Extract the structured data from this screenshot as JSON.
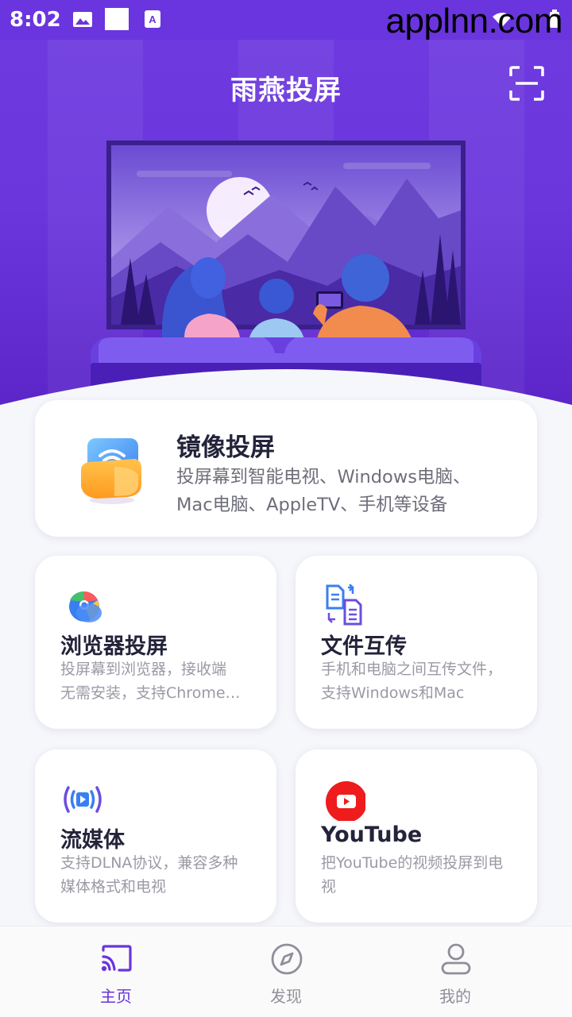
{
  "status_bar": {
    "time": "8:02",
    "icons": [
      "image-icon",
      "square-icon",
      "font-icon",
      "wifi-icon",
      "battery-icon"
    ],
    "watermark": "applnn.com"
  },
  "header": {
    "title": "雨燕投屏",
    "scan_icon": "scan-icon",
    "background_color": "#6b36dc"
  },
  "mirror_card": {
    "title": "镜像投屏",
    "description_lines": [
      "投屏幕到智能电视、Windows电脑、",
      "Mac电脑、AppleTV、手机等设备"
    ],
    "icon": "wifi-cast-icon"
  },
  "features": [
    {
      "title": "浏览器投屏",
      "desc_lines": [
        "投屏幕到浏览器，接收端",
        "无需安装，支持Chrome…"
      ],
      "icon": "browser-icon"
    },
    {
      "title": "文件互传",
      "desc_lines": [
        "手机和电脑之间互传文件，",
        "支持Windows和Mac"
      ],
      "icon": "file-transfer-icon"
    },
    {
      "title": "流媒体",
      "desc_lines": [
        "支持DLNA协议，兼容多种",
        "媒体格式和电视"
      ],
      "icon": "stream-icon"
    },
    {
      "title": "YouTube",
      "desc_lines": [
        "把YouTube的视频投屏到电",
        "视"
      ],
      "icon": "youtube-icon"
    }
  ],
  "bottom_nav": {
    "items": [
      {
        "label": "主页",
        "icon": "cast-icon",
        "active": true
      },
      {
        "label": "发现",
        "icon": "compass-icon",
        "active": false
      },
      {
        "label": "我的",
        "icon": "user-icon",
        "active": false
      }
    ],
    "active_color": "#6b34dc"
  }
}
